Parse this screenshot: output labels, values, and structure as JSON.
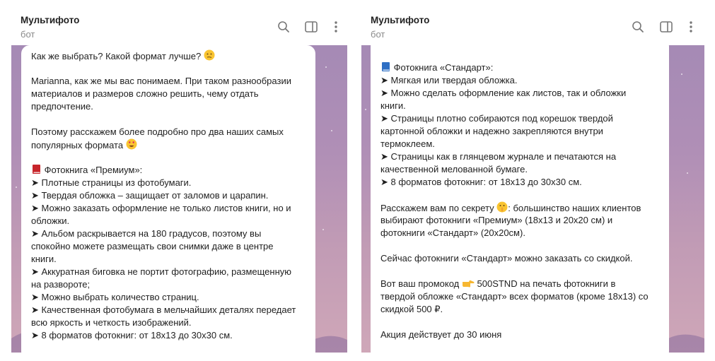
{
  "chat": {
    "title": "Мультифото",
    "subtitle": "бот"
  },
  "icons": [
    "search-icon",
    "sidebar-toggle-icon",
    "more-vertical-icon",
    "thinking-emoji",
    "heart-eyes-emoji",
    "red-book-emoji",
    "blue-book-emoji",
    "shushing-emoji",
    "pointing-right-emoji"
  ],
  "colors": {
    "chat_bg_top": "#a58ab5",
    "chat_bg_bottom": "#cfa7b8",
    "text": "#1f1f1f",
    "muted": "#8a8a8a"
  },
  "left_message": {
    "lines": [
      "Как же выбрать? Какой формат лучше?",
      "",
      "Marianna, как же мы вас понимаем. При таком разнообразии",
      "материалов и размеров сложно решить, чему отдать",
      "предпочтение.",
      "",
      "Поэтому расскажем более подробно про два наших самых",
      "популярных формата",
      "",
      "Фотокнига «Премиум»:",
      "➤ Плотные страницы из фотобумаги.",
      "➤ Твердая обложка – защищает от заломов и царапин.",
      "➤ Можно заказать оформление не только листов книги, но и",
      "обложки.",
      "➤ Альбом раскрывается на 180 градусов, поэтому вы",
      "спокойно можете размещать свои снимки даже в центре",
      "книги.",
      "➤ Аккуратная биговка не портит фотографию, размещенную",
      "на развороте;",
      "➤ Можно выбрать количество страниц.",
      "➤ Качественная фотобумага в мельчайших деталях передает",
      "всю яркость и четкость изображений.",
      "➤ 8 форматов фотокниг: от 18х13 до 30х30 см."
    ]
  },
  "right_message": {
    "lines": [
      "Фотокнига «Стандарт»:",
      "➤ Мягкая или твердая обложка.",
      "➤ Можно сделать оформление как листов, так и обложки",
      "книги.",
      "➤ Страницы плотно собираются под корешок твердой",
      "картонной обложки и надежно закрепляются внутри",
      "термоклеем.",
      "➤ Страницы как в глянцевом журнале и печатаются на",
      "качественной мелованной бумаге.",
      "➤ 8 форматов фотокниг: от 18х13 до 30х30 см.",
      "",
      "Расскажем вам по секрету",
      ": большинство наших клиентов",
      "выбирают фотокниги «Премиум» (18х13 и 20х20 см) и",
      "фотокниги «Стандарт» (20х20см).",
      "",
      "Сейчас фотокниги «Стандарт» можно заказать со скидкой.",
      "",
      "Вот ваш промокод",
      "500STND на печать фотокниги в",
      "твердой обложке «Стандарт» всех форматов (кроме 18х13) со",
      "скидкой 500 ₽.",
      "",
      "Акция действует до 30 июня"
    ]
  }
}
